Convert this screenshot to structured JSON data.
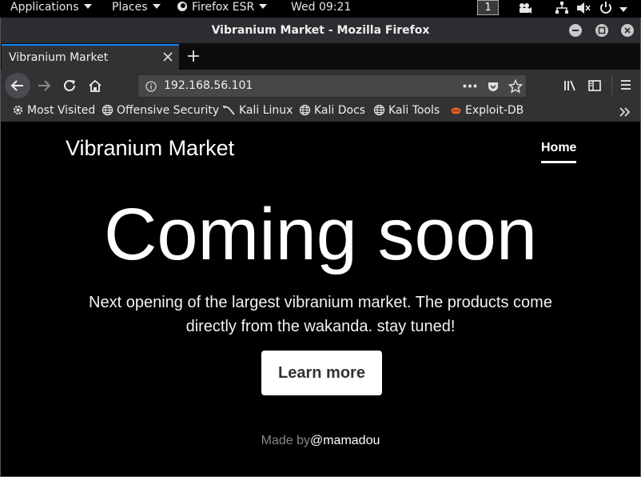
{
  "topbar": {
    "applications": "Applications",
    "places": "Places",
    "firefox": "Firefox ESR",
    "clock": "Wed 09:21",
    "workspace": "1"
  },
  "window": {
    "title": "Vibranium Market - Mozilla Firefox"
  },
  "tabs": [
    {
      "label": "Vibranium Market",
      "active": true
    }
  ],
  "urlbar": {
    "url": "192.168.56.101"
  },
  "bookmarks": [
    {
      "label": "Most Visited",
      "icon": "gear-icon"
    },
    {
      "label": "Offensive Security",
      "icon": "globe-icon"
    },
    {
      "label": "Kali Linux",
      "icon": "kali-dragon-icon"
    },
    {
      "label": "Kali Docs",
      "icon": "globe-icon"
    },
    {
      "label": "Kali Tools",
      "icon": "globe-icon"
    },
    {
      "label": "Exploit-DB",
      "icon": "exploit-db-icon"
    }
  ],
  "site": {
    "brand": "Vibranium Market",
    "nav": [
      {
        "label": "Home",
        "active": true
      }
    ],
    "headline": "Coming soon",
    "lead_line1": "Next opening of the largest vibranium market. The products come",
    "lead_line2": "directly from the wakanda. stay tuned!",
    "cta": "Learn more",
    "footer_prefix": "Made by",
    "footer_author": "@mamadou"
  },
  "colors": {
    "accent": "#0a84ff",
    "page_bg": "#000000",
    "chrome_bg": "#323234"
  }
}
